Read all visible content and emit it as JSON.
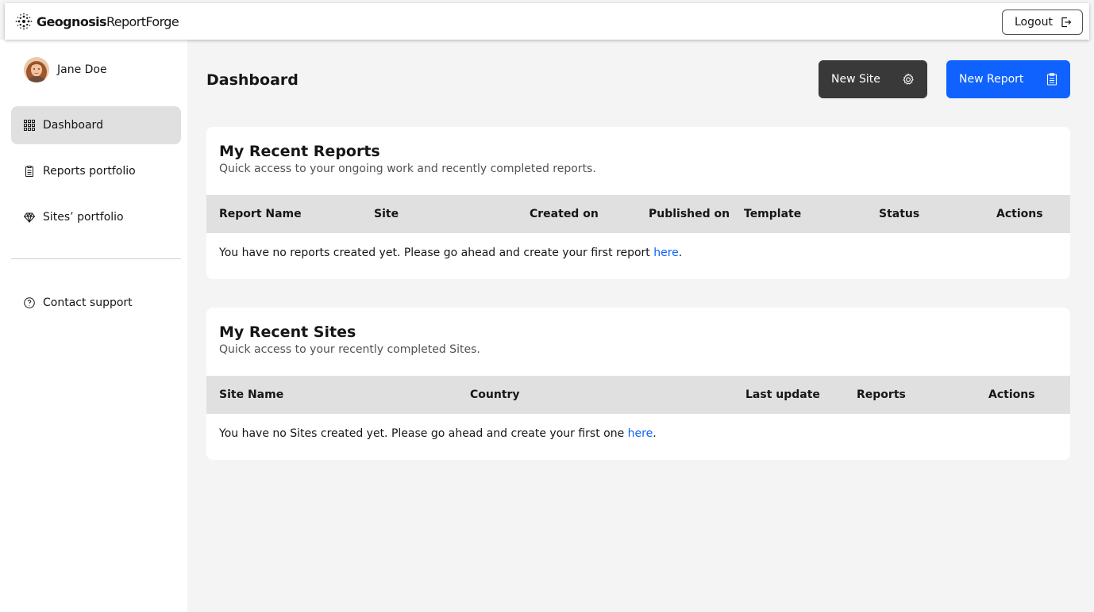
{
  "brand": {
    "strong": "Geognosis",
    "light": "ReportForge"
  },
  "header": {
    "logout_label": "Logout"
  },
  "user": {
    "name": "Jane Doe"
  },
  "sidebar": {
    "items": [
      {
        "label": "Dashboard",
        "icon": "grid-icon",
        "active": true
      },
      {
        "label": "Reports portfolio",
        "icon": "clipboard-icon",
        "active": false
      },
      {
        "label": "Sites’ portfolio",
        "icon": "diamond-icon",
        "active": false
      }
    ],
    "support": {
      "label": "Contact support",
      "icon": "help-circle-icon"
    }
  },
  "page": {
    "title": "Dashboard",
    "new_site_label": "New Site",
    "new_report_label": "New Report"
  },
  "reports": {
    "title": "My Recent Reports",
    "subtitle": "Quick access to your ongoing work and recently completed reports.",
    "columns": [
      "Report Name",
      "Site",
      "Created on",
      "Published on",
      "Template",
      "Status",
      "Actions"
    ],
    "empty_text": "You have no reports created yet. Please go ahead and create your first report ",
    "empty_link": "here",
    "empty_end": "."
  },
  "sites": {
    "title": "My Recent Sites",
    "subtitle": "Quick access to your recently completed Sites.",
    "columns": [
      "Site Name",
      "Country",
      "Last update",
      "Reports",
      "Actions"
    ],
    "empty_text": "You have no Sites created yet. Please go ahead and create your first one ",
    "empty_link": "here",
    "empty_end": "."
  },
  "colors": {
    "primary": "#0f62fe",
    "dark_button": "#393939",
    "active_nav": "#e0e0e0",
    "table_header": "#e0e0e0"
  }
}
